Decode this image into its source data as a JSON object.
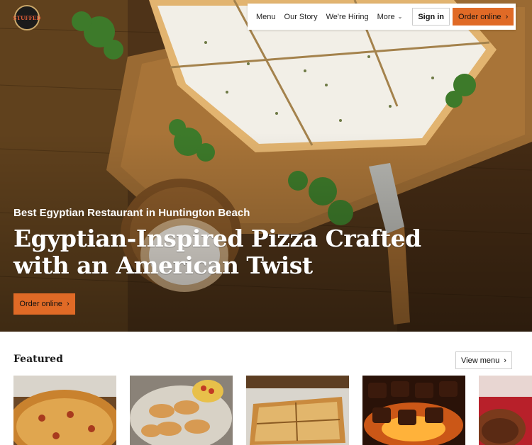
{
  "brand": {
    "logo_text": "STUFFED"
  },
  "nav": {
    "items": [
      {
        "label": "Menu"
      },
      {
        "label": "Our Story"
      },
      {
        "label": "We're Hiring"
      },
      {
        "label": "More"
      }
    ],
    "signin_label": "Sign in",
    "order_label": "Order online"
  },
  "hero": {
    "subhead": "Best Egyptian Restaurant in Huntington Beach",
    "headline_line1": "Egyptian-Inspired Pizza Crafted",
    "headline_line2": "with an American Twist",
    "cta_label": "Order online"
  },
  "featured": {
    "title": "Featured",
    "view_menu_label": "View menu"
  },
  "icons": {
    "chevron_right": "›",
    "chevron_down": "⌄"
  },
  "colors": {
    "accent": "#e06a26"
  }
}
